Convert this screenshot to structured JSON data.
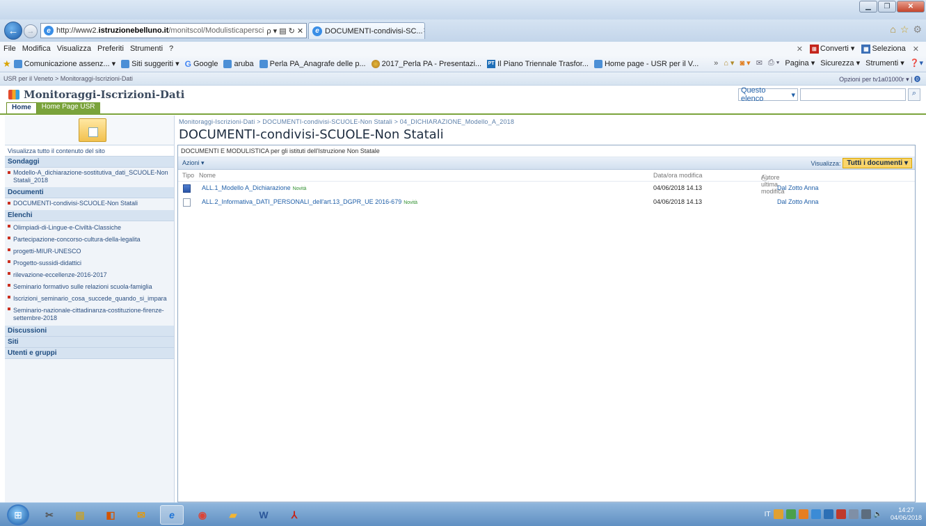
{
  "browser": {
    "url_prefix": "http://www2.",
    "url_domain": "istruzionebelluno.it",
    "url_rest": "/monitscol/Modulisticapersci",
    "addr_tools": "ρ ▾ ▤ ↻ ✕",
    "tab_title": "DOCUMENTI-condivisi-SC...",
    "tab_close": "✕",
    "menu": [
      "File",
      "Modifica",
      "Visualizza",
      "Preferiti",
      "Strumenti",
      "?"
    ],
    "menu_right": {
      "converti": "Converti ▾",
      "seleziona": "Seleziona"
    },
    "favorites": [
      {
        "label": "Comunicazione assenz... ▾",
        "icon": "page-icon"
      },
      {
        "label": "Siti suggeriti ▾",
        "icon": "page-icon"
      },
      {
        "label": "Google",
        "icon": "google-icon"
      },
      {
        "label": "aruba",
        "icon": "page-icon"
      },
      {
        "label": "Perla PA_Anagrafe delle p...",
        "icon": "page-icon"
      },
      {
        "label": "2017_Perla PA - Presentazi...",
        "icon": "flag-icon"
      },
      {
        "label": "Il Piano Triennale Trasfor...",
        "icon": "pt-icon"
      },
      {
        "label": "Home page - USR per il V...",
        "icon": "page-icon"
      }
    ],
    "cmd": [
      "Pagina ▾",
      "Sicurezza ▾",
      "Strumenti ▾"
    ]
  },
  "sharepoint": {
    "topbar_crumb": "USR per il Veneto > Monitoraggi-Iscrizioni-Dati",
    "topbar_right": "Opzioni per tv1a01000r ▾",
    "site_title": "Monitoraggi-Iscrizioni-Dati",
    "search_scope": "Questo elenco",
    "tabs": [
      "Home",
      "Home Page USR"
    ],
    "breadcrumb": "Monitoraggi-Iscrizioni-Dati > DOCUMENTI-condivisi-SCUOLE-Non Statali > 04_DICHIARAZIONE_Modello_A_2018",
    "page_title": "DOCUMENTI-condivisi-SCUOLE-Non Statali"
  },
  "leftnav": {
    "view_all": "Visualizza tutto il contenuto del sito",
    "sections": [
      {
        "title": "Sondaggi",
        "items": [
          "Modello-A_dichiarazione-sostitutiva_dati_SCUOLE-Non Statali_2018"
        ]
      },
      {
        "title": "Documenti",
        "items": [
          "DOCUMENTI-condivisi-SCUOLE-Non Statali"
        ]
      },
      {
        "title": "Elenchi",
        "items": [
          "Olimpiadi-di-Lingue-e-Civiltà-Classiche",
          "Partecipazione-concorso-cultura-della-legalita",
          "progetti-MIUR-UNESCO",
          "Progetto-sussidi-didattici",
          "rilevazione-eccellenze-2016-2017",
          "Seminario formativo sulle relazioni scuola-famiglia",
          "Iscrizioni_seminario_cosa_succede_quando_si_impara",
          "Seminario-nazionale-cittadinanza-costituzione-firenze-settembre-2018"
        ]
      },
      {
        "title": "Discussioni",
        "items": []
      },
      {
        "title": "Siti",
        "items": []
      },
      {
        "title": "Utenti e gruppi",
        "items": []
      }
    ]
  },
  "list": {
    "description": "DOCUMENTI E MODULISTICA per gli istituti dell'Istruzione Non Statale",
    "actions_label": "Azioni ▾",
    "view_label": "Visualizza:",
    "view_value": "Tutti i documenti ▾",
    "columns": {
      "type": "Tipo",
      "name": "Nome",
      "modified": "Data/ora modifica",
      "author": "Autore ultima modifica"
    },
    "rows": [
      {
        "icon": "word-doc-icon",
        "name": "ALL.1_Modello A_Dichiarazione",
        "badge": "Novità",
        "modified": "04/06/2018 14.13",
        "author": "Dal Zotto Anna"
      },
      {
        "icon": "generic-doc-icon",
        "name": "ALL.2_Informativa_DATI_PERSONALI_dell'art.13_DGPR_UE 2016-679",
        "badge": "Novità",
        "modified": "04/06/2018 14.13",
        "author": "Dal Zotto Anna"
      }
    ]
  },
  "taskbar": {
    "tray_lang": "IT",
    "time": "14:27",
    "date": "04/06/2018"
  }
}
